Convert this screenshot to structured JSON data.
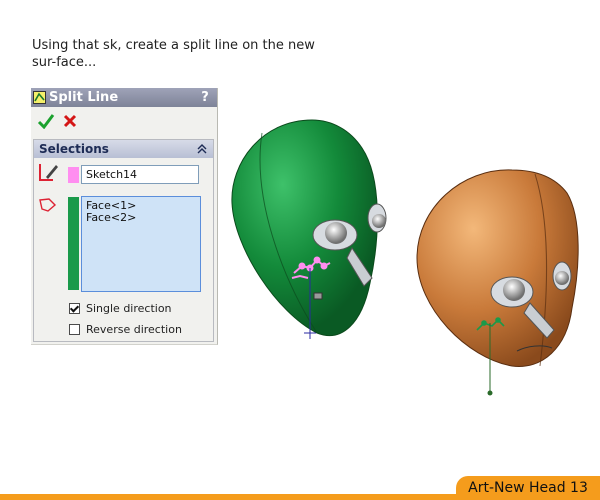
{
  "instruction": "Using that sk, create a split line on the new sur-face...",
  "panel": {
    "title": "Split Line",
    "help": "?",
    "ok_icon": "checkmark-icon",
    "cancel_icon": "x-icon",
    "selections": {
      "header": "Selections",
      "sketch_value": "Sketch14",
      "faces": [
        "Face<1>",
        "Face<2>"
      ],
      "single_direction": "Single direction",
      "reverse_direction": "Reverse direction",
      "single_checked": true,
      "reverse_checked": false
    }
  },
  "footer": {
    "label": "Art-New Head 13"
  },
  "colors": {
    "accent": "#f59c1c",
    "green_head": "#1f8a3e",
    "copper_head": "#c97a3a",
    "sketch_pink": "#ff8ef0"
  }
}
